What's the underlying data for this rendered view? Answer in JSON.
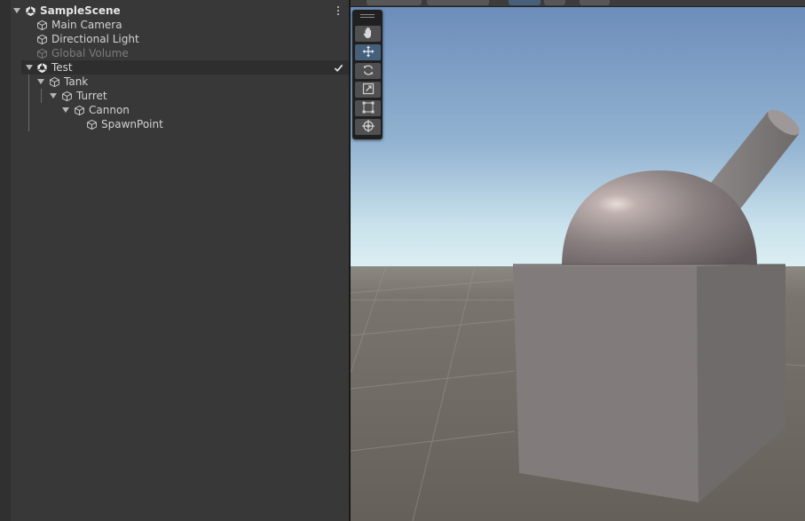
{
  "hierarchy": {
    "scene": {
      "name": "SampleScene",
      "icon": "unity-scene-icon",
      "menu_icon": "kebab-menu-icon"
    },
    "items": [
      {
        "label": "Main Camera",
        "icon": "cube-icon"
      },
      {
        "label": "Directional Light",
        "icon": "cube-icon"
      },
      {
        "label": "Global Volume",
        "icon": "cube-icon",
        "disabled": true
      },
      {
        "label": "Test",
        "icon": "unity-scene-icon",
        "selected": true,
        "state_icon": "checkmark-icon"
      },
      {
        "label": "Tank",
        "icon": "cube-icon",
        "expanded": true
      },
      {
        "label": "Turret",
        "icon": "cube-icon",
        "expanded": true
      },
      {
        "label": "Cannon",
        "icon": "cube-icon",
        "expanded": true
      },
      {
        "label": "SpawnPoint",
        "icon": "cube-icon"
      }
    ]
  },
  "scene_view": {
    "tools": [
      {
        "name": "hand-tool",
        "icon": "hand-icon"
      },
      {
        "name": "move-tool",
        "icon": "move-arrows-icon",
        "active": true
      },
      {
        "name": "rotate-tool",
        "icon": "rotate-icon"
      },
      {
        "name": "scale-tool",
        "icon": "scale-icon"
      },
      {
        "name": "rect-tool",
        "icon": "rect-transform-icon"
      },
      {
        "name": "transform-tool",
        "icon": "transform-icon"
      }
    ],
    "colors": {
      "sky_top": "#6d8db9",
      "sky_horizon": "#d8eef2",
      "ground": "#6e6862",
      "active_tool": "#46607c",
      "panel_bg": "#383838"
    }
  }
}
